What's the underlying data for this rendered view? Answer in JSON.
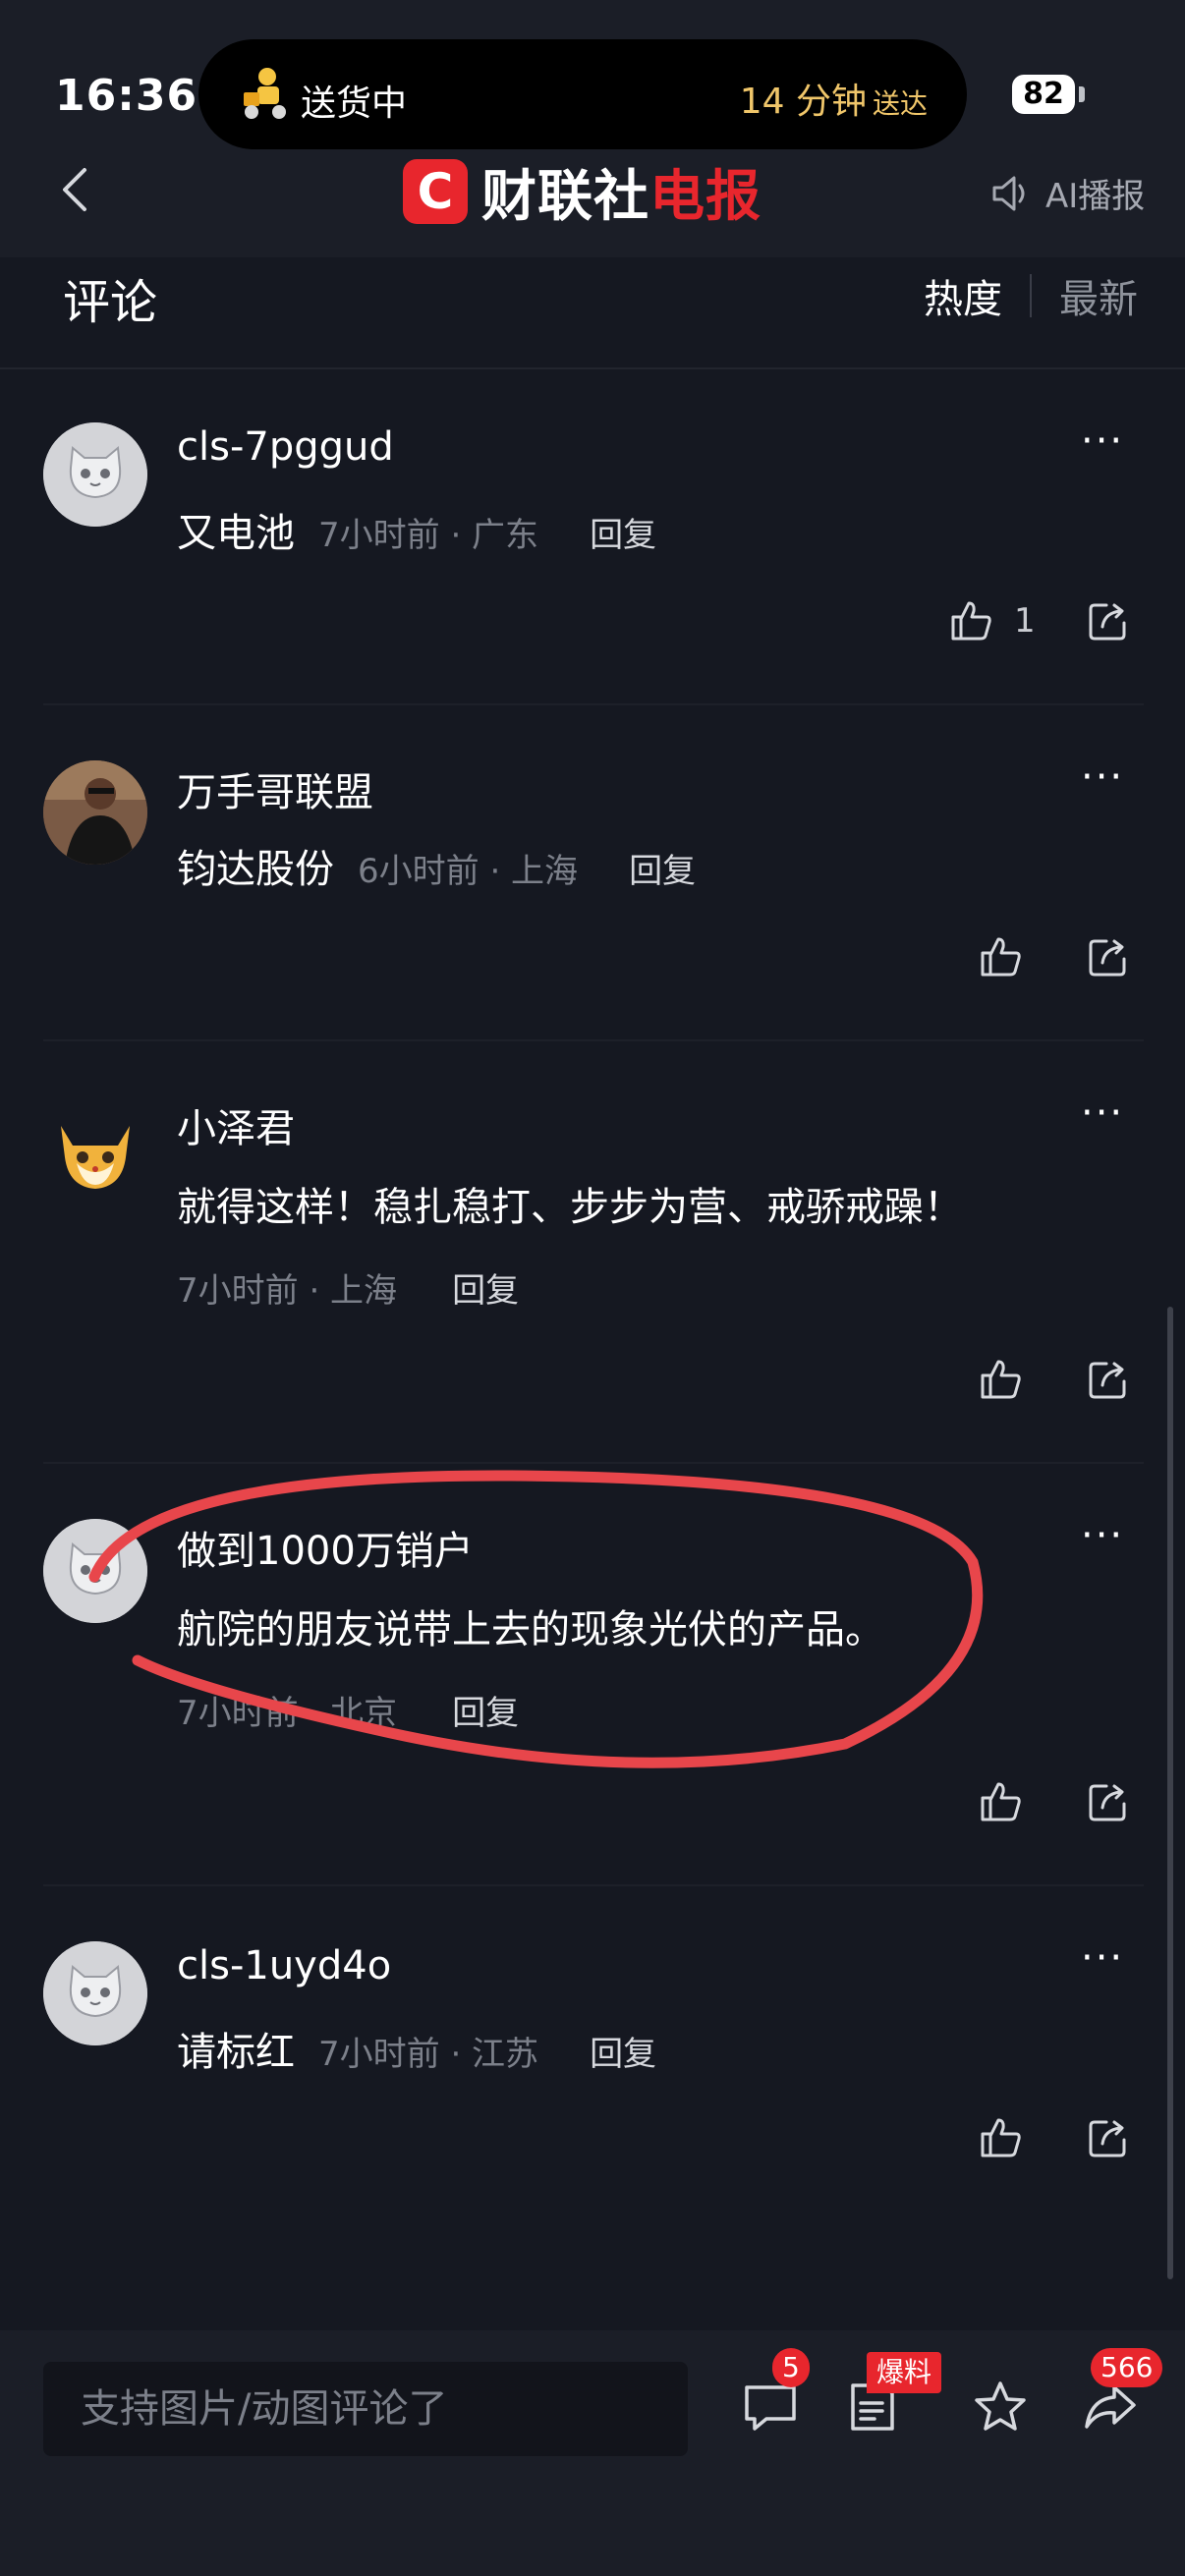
{
  "status_bar": {
    "time": "16:36",
    "live_activity_status": "送货中",
    "live_activity_eta": "14 分钟",
    "live_activity_suffix": "送达",
    "battery": "82"
  },
  "header": {
    "logo_mark": "C",
    "logo_text_main": "财联社",
    "logo_text_accent": "电报",
    "ai_label": "AI播报"
  },
  "comments_header": {
    "title": "评论",
    "sort_hot": "热度",
    "sort_new": "最新"
  },
  "comments": [
    {
      "user": "cls-7pggud",
      "text": "又电池",
      "meta": "7小时前 · 广东",
      "reply": "回复",
      "likes": "1",
      "more": "···"
    },
    {
      "user": "万手哥联盟",
      "text": "钧达股份",
      "meta": "6小时前 · 上海",
      "reply": "回复",
      "likes": "",
      "more": "···"
    },
    {
      "user": "小泽君",
      "text": "就得这样！稳扎稳打、步步为营、戒骄戒躁！",
      "meta": "7小时前 · 上海",
      "reply": "回复",
      "likes": "",
      "more": "···"
    },
    {
      "user": "做到1000万销户",
      "text": "航院的朋友说带上去的现象光伏的产品。",
      "meta": "7小时前 · 北京",
      "reply": "回复",
      "likes": "",
      "more": "···"
    },
    {
      "user": "cls-1uyd4o",
      "text": "请标红",
      "meta": "7小时前 · 江苏",
      "reply": "回复",
      "likes": "",
      "more": "···"
    }
  ],
  "bottom_bar": {
    "input_placeholder": "支持图片/动图评论了",
    "comment_badge": "5",
    "tip_flag": "爆料",
    "share_badge": "566"
  },
  "colors": {
    "background": "#151821",
    "brand_red": "#e8262d",
    "eta_gold": "#f0c66a",
    "annotation_red": "#e8464b"
  }
}
